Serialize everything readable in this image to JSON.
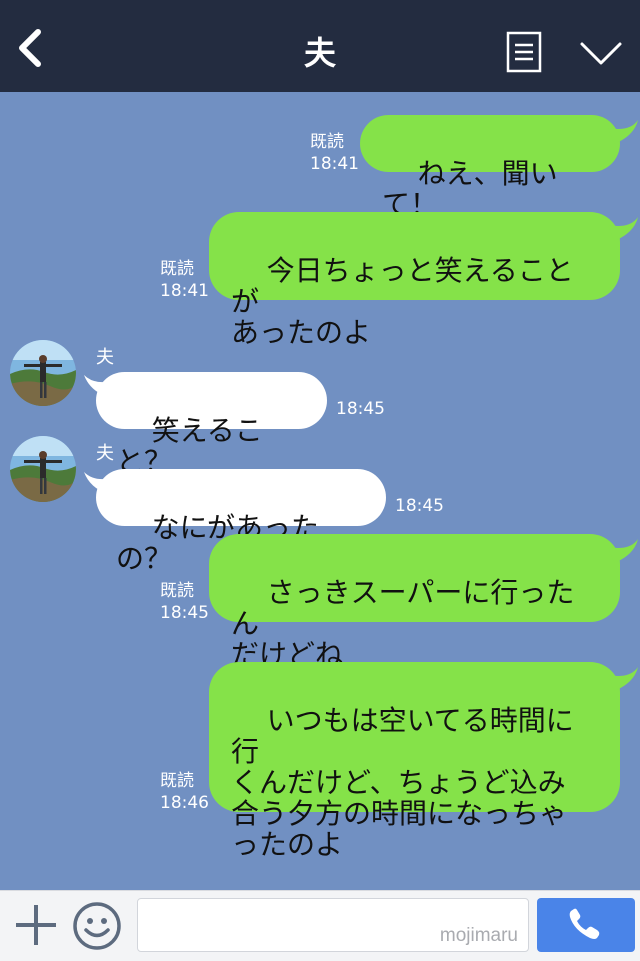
{
  "header": {
    "title": "夫"
  },
  "messages": [
    {
      "dir": "out",
      "text": "ねえ、聞いて！",
      "read": "既読",
      "time": "18:41"
    },
    {
      "dir": "out",
      "text": "今日ちょっと笑えることが\nあったのよ",
      "read": "既読",
      "time": "18:41"
    },
    {
      "dir": "in",
      "sender": "夫",
      "text": "笑えること？",
      "time": "18:45"
    },
    {
      "dir": "in",
      "sender": "夫",
      "text": "なにがあったの？",
      "time": "18:45"
    },
    {
      "dir": "out",
      "text": "さっきスーパーに行ったん\nだけどね",
      "read": "既読",
      "time": "18:45"
    },
    {
      "dir": "out",
      "text": "いつもは空いてる時間に行\nくんだけど、ちょうど込み\n合う夕方の時間になっちゃ\nったのよ",
      "read": "既読",
      "time": "18:46"
    }
  ],
  "input": {
    "watermark": "mojimaru"
  },
  "colors": {
    "header": "#232c40",
    "background": "#7190c2",
    "outgoing": "#85e249",
    "incoming": "#ffffff",
    "call": "#4a84e8"
  }
}
